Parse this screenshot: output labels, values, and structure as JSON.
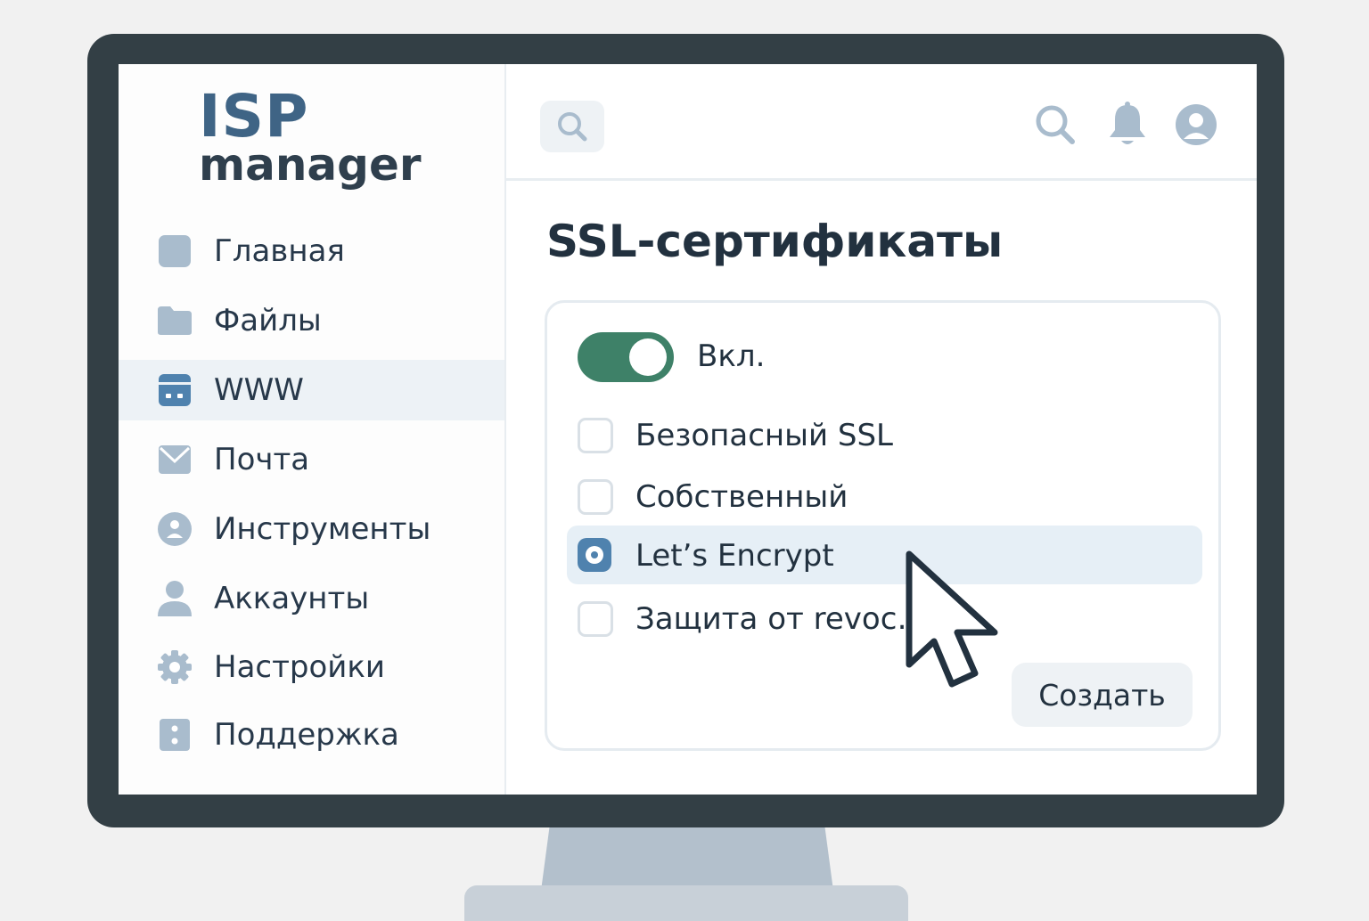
{
  "logo": {
    "line1": "ISP",
    "line2": "manager"
  },
  "sidebar": {
    "items": [
      {
        "label": "Главная",
        "icon": "home-square-icon"
      },
      {
        "label": "Файлы",
        "icon": "folder-icon"
      },
      {
        "label": "WWW",
        "icon": "www-window-icon",
        "active": true
      },
      {
        "label": "Почта",
        "icon": "mail-icon"
      },
      {
        "label": "Инструменты",
        "icon": "tools-icon"
      },
      {
        "label": "Аккаунты",
        "icon": "user-icon"
      },
      {
        "label": "Настройки",
        "icon": "gear-icon"
      },
      {
        "label": "Поддержка",
        "icon": "support-icon"
      }
    ]
  },
  "topbar": {
    "icons": [
      "search-icon",
      "bell-icon",
      "avatar-icon"
    ]
  },
  "main": {
    "title": "SSL-сертификаты",
    "toggle": {
      "label": "Вкл.",
      "on": true
    },
    "options": [
      {
        "label": "Безопасный SSL",
        "checked": false
      },
      {
        "label": "Собственный",
        "checked": false
      },
      {
        "label": "Let’s Encrypt",
        "checked": true
      },
      {
        "label": "Защита от revoc…",
        "checked": false
      }
    ],
    "create_label": "Создать"
  },
  "colors": {
    "accent": "#4f82ae",
    "toggle_on": "#3e8168",
    "frame": "#333f45",
    "selected_row": "#e6eff6"
  }
}
